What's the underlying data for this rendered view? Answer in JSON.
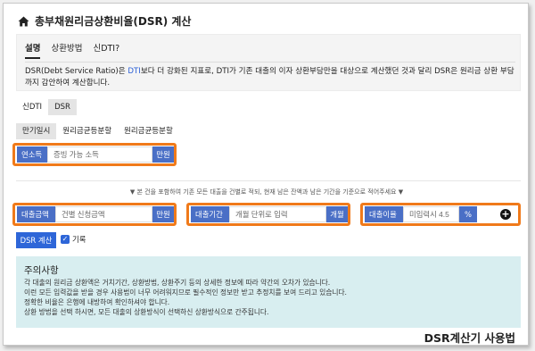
{
  "header": {
    "title": "총부채원리금상환비율(DSR) 계산",
    "icon": "home-icon"
  },
  "info": {
    "tabs": [
      {
        "label": "설명",
        "active": true
      },
      {
        "label": "상환방법",
        "active": false
      },
      {
        "label": "신DTI?",
        "active": false
      }
    ],
    "desc_pre": "DSR(Debt Service Ratio)은 ",
    "desc_hl": "DTI",
    "desc_post": "보다 더 강화된 지표로, DTI가 기존 대출의 이자 상환부담만을 대상으로 계산했던 것과 달리 DSR은 원리금 상환 부담까지 감안하여 계산합니다."
  },
  "mode_tabs": [
    {
      "label": "신DTI",
      "active": false
    },
    {
      "label": "DSR",
      "active": true
    }
  ],
  "repay_tabs": [
    {
      "label": "만기일시",
      "active": true
    },
    {
      "label": "원리금균등분할",
      "active": false
    },
    {
      "label": "원리금균등분할",
      "active": false
    }
  ],
  "income": {
    "label": "연소득",
    "placeholder": "증빙 가능 소득",
    "unit": "만원"
  },
  "hint": "▼ 본 건을 포함하여 기존 모든 대출을 건별로 적되, 현재 남은 잔액과 남은 기간을 기준으로 적어주세요 ▼",
  "loan_amount": {
    "label": "대출금액",
    "placeholder": "건별 신청금액",
    "unit": "만원"
  },
  "loan_period": {
    "label": "대출기간",
    "placeholder": "개월 단위로 입력",
    "unit": "개월"
  },
  "loan_rate": {
    "label": "대출이율",
    "placeholder": "미입력시 4.5",
    "unit": "%"
  },
  "calc_button": "DSR 계산",
  "record_label": "기록",
  "record_checked": true,
  "caution": {
    "title": "주의사항",
    "items": [
      "각 대출의 원리금 상환액은 거치기간, 상환방법, 상환주기 등의 상세한 정보에 따라 약간의 오차가 있습니다.",
      "이런 모든 입력값을 받을 경우 사용법이 너무 어려워지므로 필수적인 정보만 받고 추정치를 보여 드리고 있습니다.",
      "정확한 비율은 은행에 내방하여 확인하셔야 합니다.",
      "상환 방법을 선택 하시면, 모든 대출의 상환방식이 선택하신 상환방식으로 간주됩니다."
    ]
  },
  "watermark": "DSR계산기 사용법",
  "colors": {
    "accent": "#4a6fc6",
    "button": "#2e66d8",
    "highlight": "#f07a1a",
    "caution_bg": "#d8eef0"
  }
}
